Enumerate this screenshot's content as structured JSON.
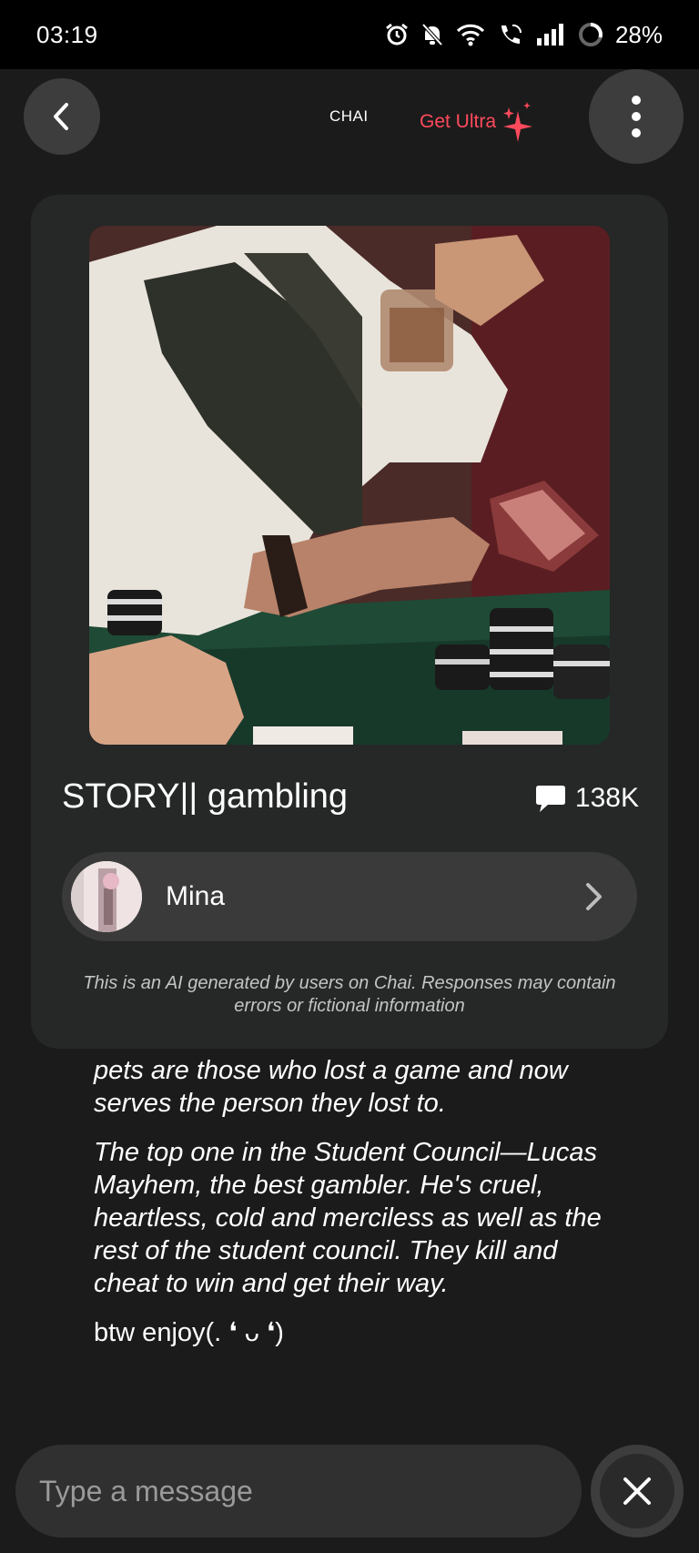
{
  "status_bar": {
    "time": "03:19",
    "battery": "28%",
    "icons": [
      "alarm-icon",
      "bell-off-icon",
      "wifi-icon",
      "wifi-call-icon",
      "signal-icon",
      "battery-icon"
    ]
  },
  "header": {
    "brand": "CHAI",
    "upgrade_label": "Get Ultra",
    "accent_color": "#ff4a5c"
  },
  "bot_card": {
    "title": "STORY|| gambling",
    "message_count": "138K",
    "creator_name": "Mina",
    "disclaimer": "This is an AI generated by users on Chai. Responses may contain errors or fictional information"
  },
  "chat": {
    "paragraphs": [
      "pets are those who lost a game and now serves the person they lost to.",
      "The top one in the Student Council—Lucas Mayhem, the best gambler. He's cruel, heartless, cold and merciless as well as the rest of the student council. They kill and cheat to win and get their way.",
      "btw enjoy(. ❛ ᴗ ❛)"
    ]
  },
  "composer": {
    "placeholder": "Type a message"
  }
}
